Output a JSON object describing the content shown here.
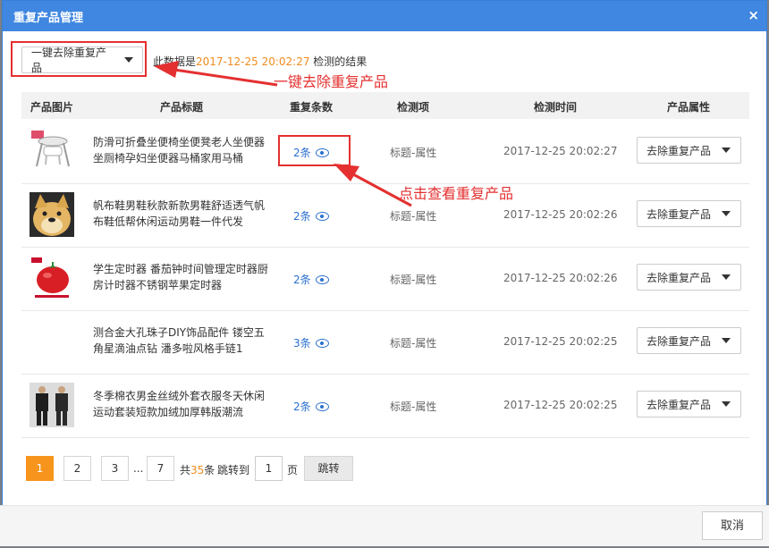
{
  "dialog": {
    "title": "重复产品管理",
    "close_symbol": "×"
  },
  "toolbar": {
    "main_button_label": "一键去除重复产品",
    "info_prefix": "此数据是",
    "info_datetime": "2017-12-25 20:02:27",
    "info_suffix": "检测的结果"
  },
  "annotations": {
    "one_click": "一键去除重复产品",
    "view_duplicates": "点击查看重复产品",
    "color": "#e43030"
  },
  "table": {
    "headers": [
      "产品图片",
      "产品标题",
      "重复条数",
      "检测项",
      "检测时间",
      "产品属性"
    ],
    "rows": [
      {
        "title": "防滑可折叠坐便椅坐便凳老人坐便器坐厕椅孕妇坐便器马桶家用马桶",
        "dup_count": "2条",
        "detect_item": "标题-属性",
        "detect_time": "2017-12-25 20:02:27",
        "action_label": "去除重复产品",
        "thumb_icon": "toilet-chair-image"
      },
      {
        "title": "帆布鞋男鞋秋款新款男鞋舒适透气帆布鞋低帮休闲运动男鞋一件代发",
        "dup_count": "2条",
        "detect_item": "标题-属性",
        "detect_time": "2017-12-25 20:02:26",
        "action_label": "去除重复产品",
        "thumb_icon": "doge-image"
      },
      {
        "title": "学生定时器 番茄钟时间管理定时器厨房计时器不锈钢苹果定时器",
        "dup_count": "2条",
        "detect_item": "标题-属性",
        "detect_time": "2017-12-25 20:02:26",
        "action_label": "去除重复产品",
        "thumb_icon": "tomato-timer-image"
      },
      {
        "title": "测合金大孔珠子DIY饰品配件 镂空五角星滴油点钻 潘多啦风格手链1",
        "dup_count": "3条",
        "detect_item": "标题-属性",
        "detect_time": "2017-12-25 20:02:25",
        "action_label": "去除重复产品",
        "thumb_icon": ""
      },
      {
        "title": "冬季棉衣男金丝绒外套衣服冬天休闲运动套装短款加绒加厚韩版潮流",
        "dup_count": "2条",
        "detect_item": "标题-属性",
        "detect_time": "2017-12-25 20:02:25",
        "action_label": "去除重复产品",
        "thumb_icon": "clothing-image"
      }
    ]
  },
  "pager": {
    "pages": [
      "1",
      "2",
      "3",
      "7"
    ],
    "ellipsis": "...",
    "total_prefix": "共",
    "total_count": "35",
    "total_suffix": "条",
    "jump_label": "跳转到",
    "jump_value": "1",
    "page_unit": "页",
    "go_label": "跳转",
    "active_color": "#f7941d"
  },
  "footer": {
    "cancel_label": "取消"
  }
}
